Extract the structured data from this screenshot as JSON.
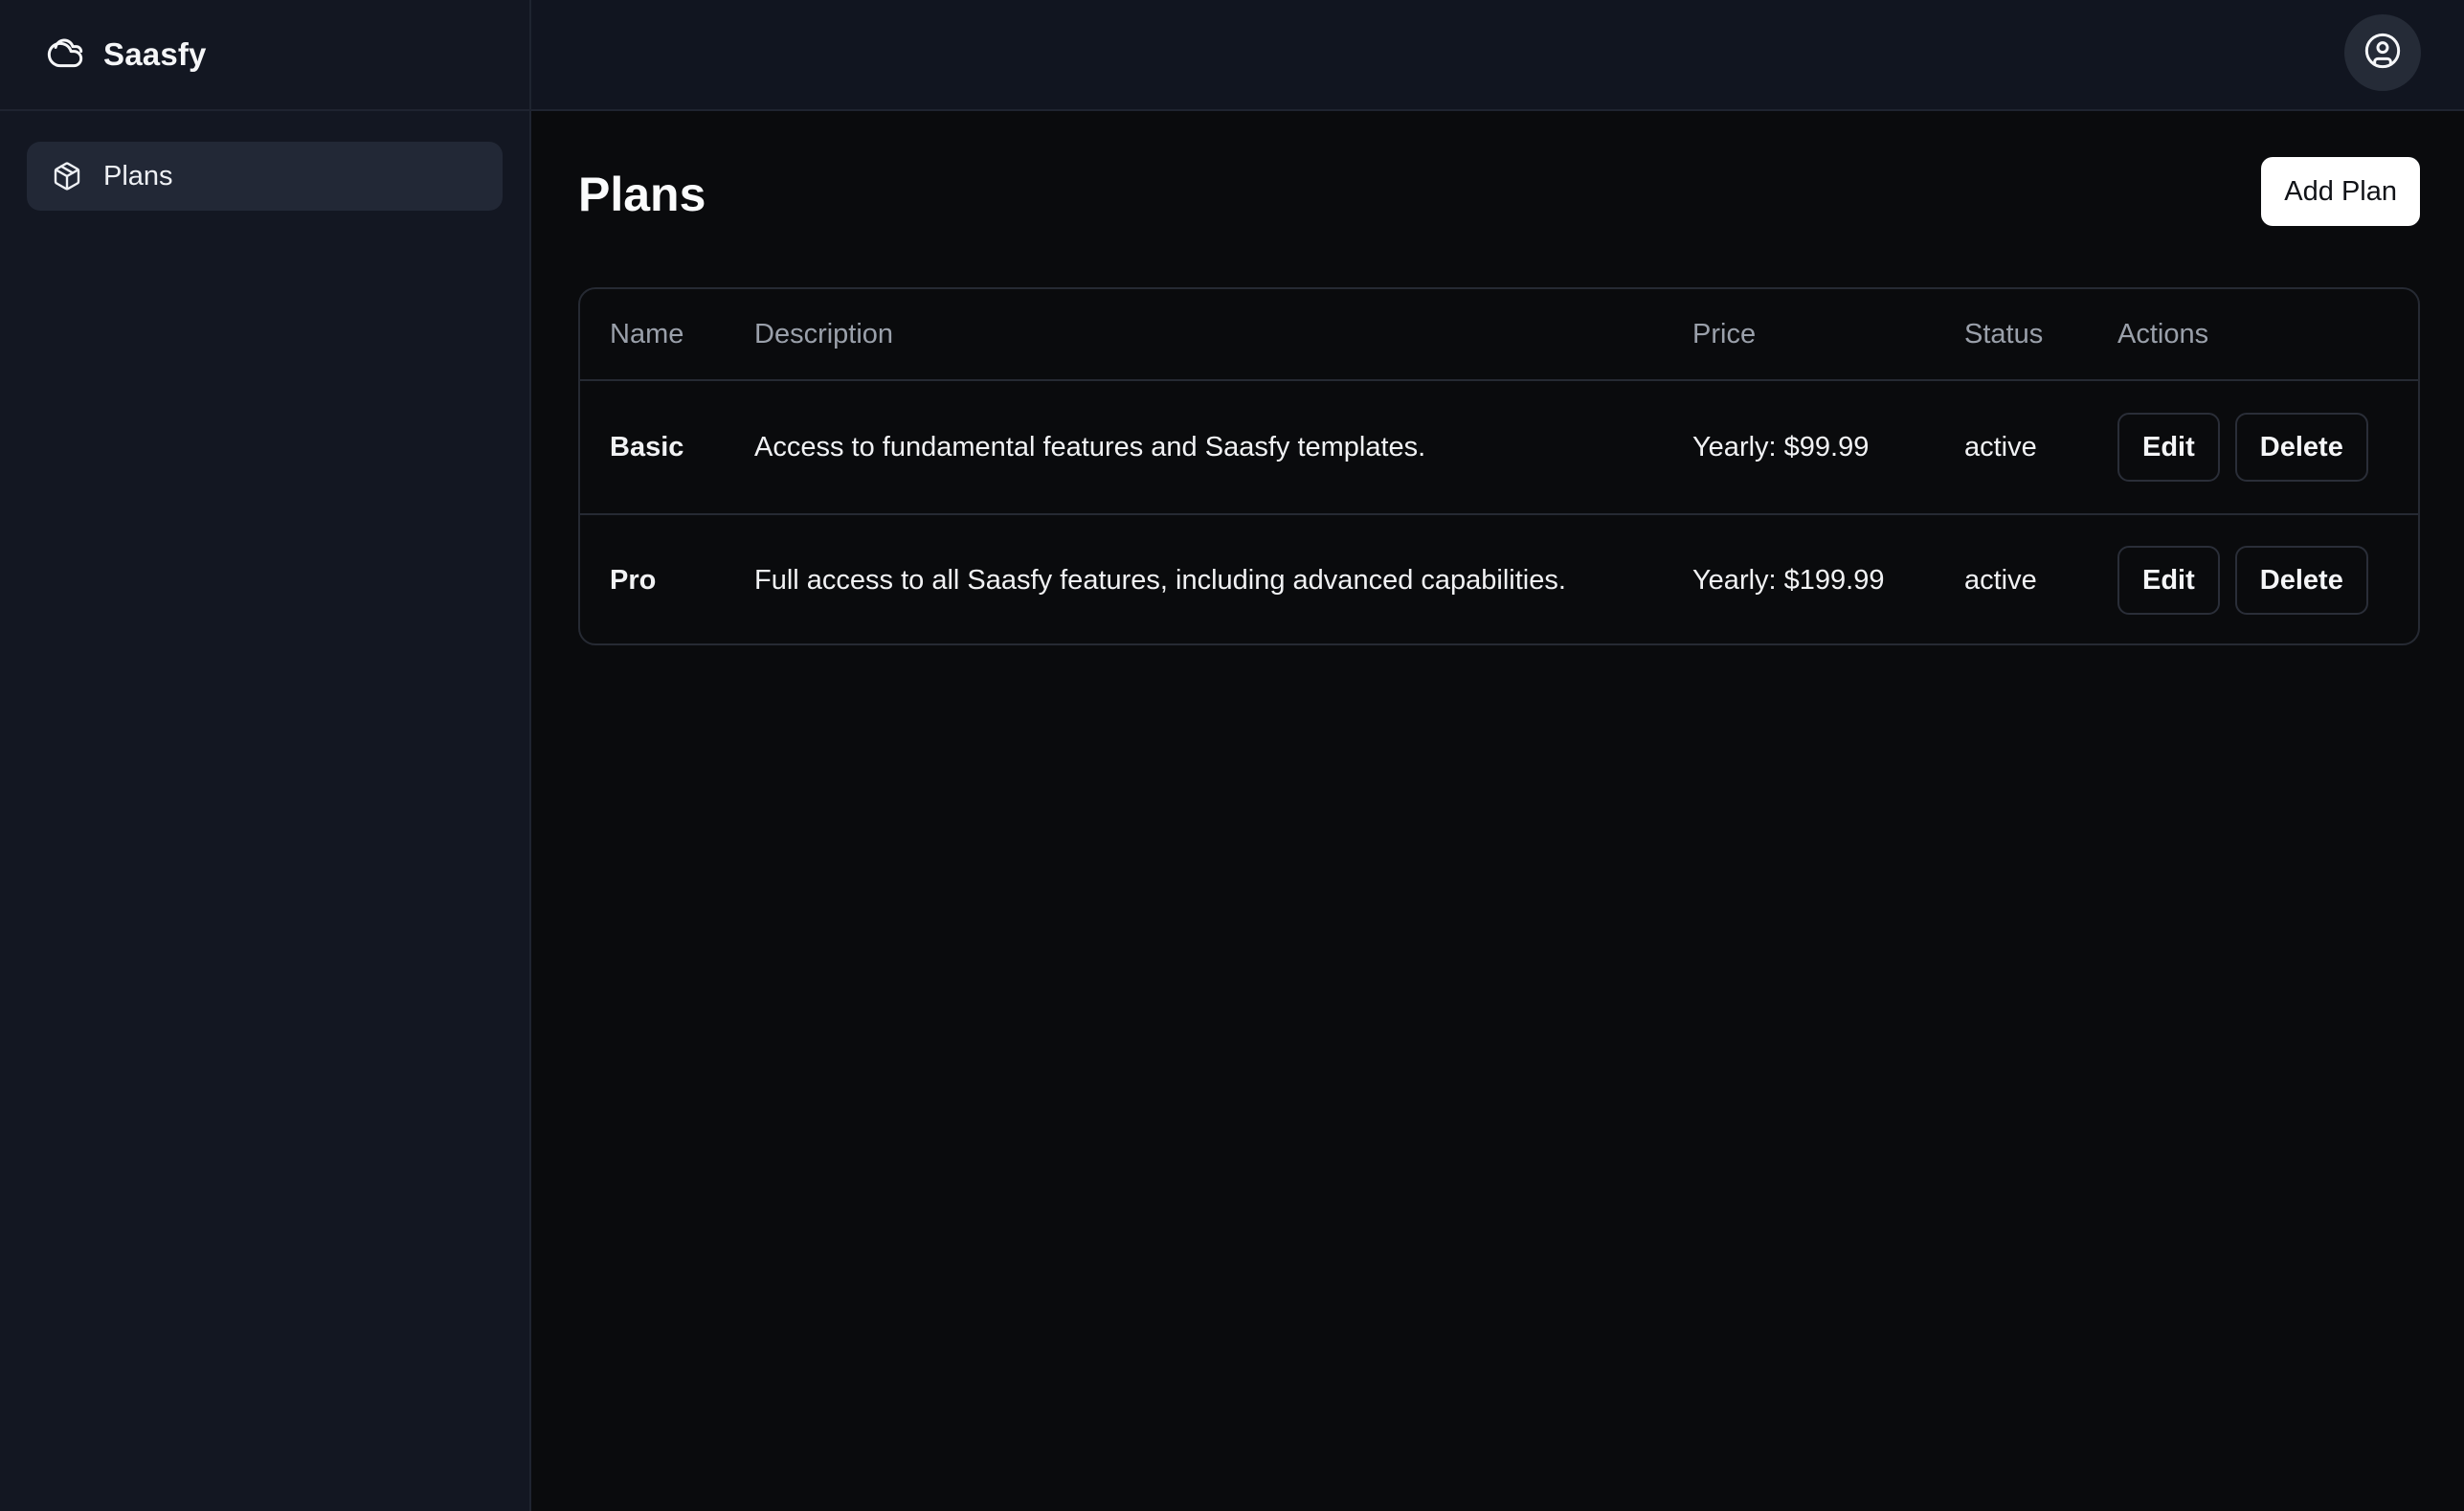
{
  "brand": {
    "name": "Saasfy",
    "icon": "cloud-icon"
  },
  "sidebar": {
    "items": [
      {
        "label": "Plans",
        "icon": "package-icon",
        "active": true
      }
    ]
  },
  "topbar": {
    "user_icon": "user-circle-icon"
  },
  "main": {
    "title": "Plans",
    "add_label": "Add Plan",
    "table": {
      "headers": {
        "name": "Name",
        "description": "Description",
        "price": "Price",
        "status": "Status",
        "actions": "Actions"
      },
      "rows": [
        {
          "name": "Basic",
          "description": "Access to fundamental features and Saasfy templates.",
          "price": "Yearly: $99.99",
          "status": "active",
          "edit_label": "Edit",
          "delete_label": "Delete"
        },
        {
          "name": "Pro",
          "description": "Full access to all Saasfy features, including advanced capabilities.",
          "price": "Yearly: $199.99",
          "status": "active",
          "edit_label": "Edit",
          "delete_label": "Delete"
        }
      ]
    }
  },
  "colors": {
    "sidebar_bg": "#131722",
    "main_bg": "#0a0b0d",
    "active_item_bg": "#222836",
    "border": "#262a33",
    "primary_button_bg": "#ffffff"
  }
}
